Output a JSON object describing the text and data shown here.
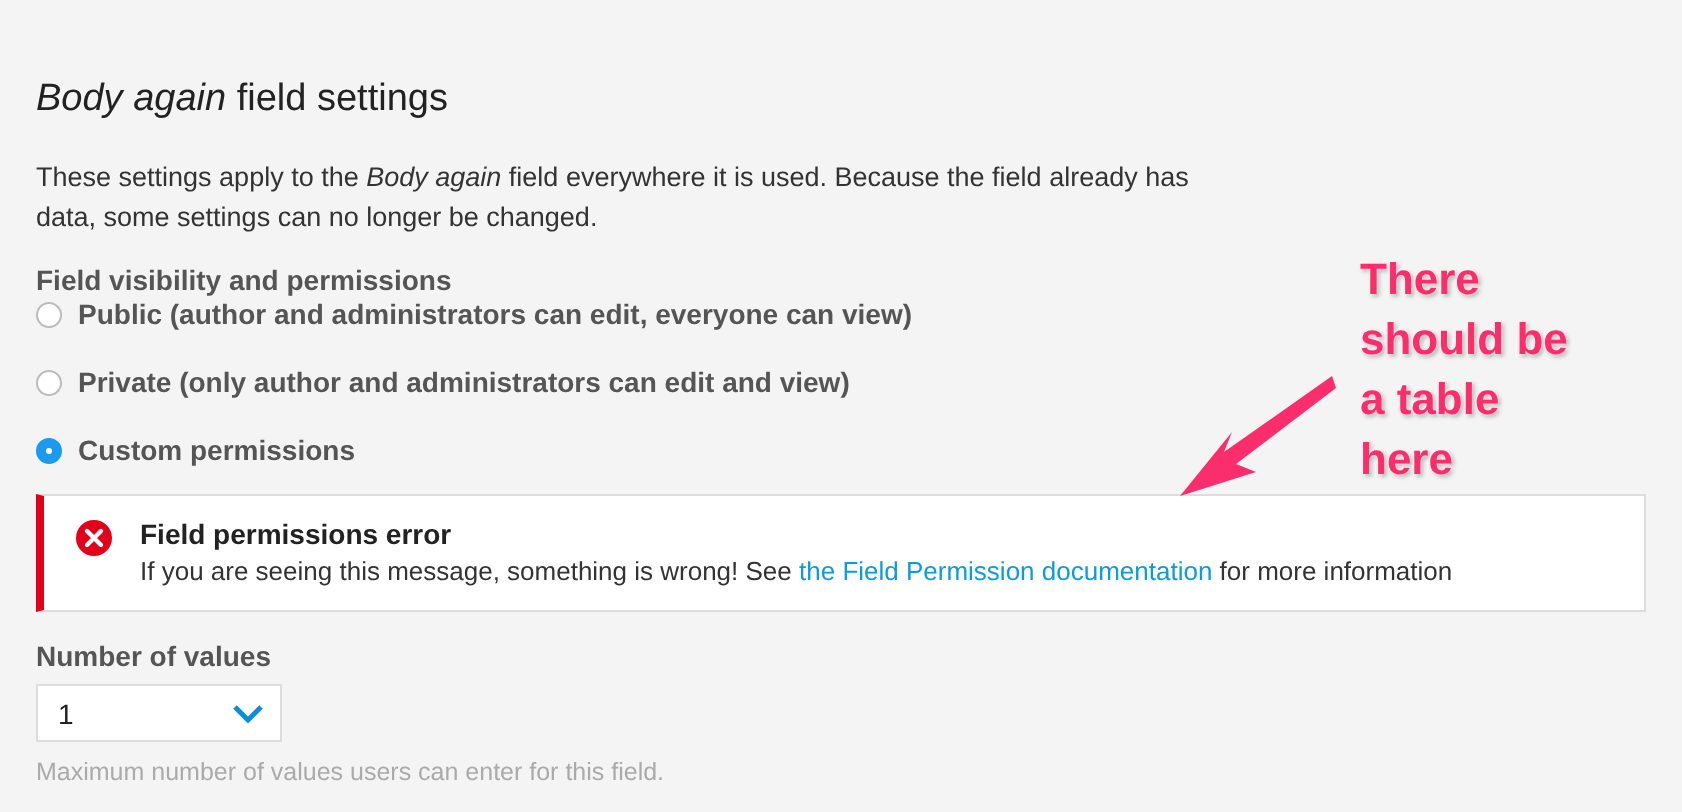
{
  "heading": {
    "title": "*Body again* field settings"
  },
  "intro": "These settings apply to the *Body again* field everywhere it is used. Because the field already has data, some settings can no longer be changed.",
  "visibility": {
    "label": "Field visibility and permissions",
    "options": [
      {
        "label": "Public (author and administrators can edit, everyone can view)",
        "selected": false
      },
      {
        "label": "Private (only author and administrators can edit and view)",
        "selected": false
      },
      {
        "label": "Custom permissions",
        "selected": true
      }
    ]
  },
  "error": {
    "title": "Field permissions error",
    "text_before": "If you are seeing this message, something is wrong! See",
    "link": "the Field Permission documentation",
    "text_after": "for more information"
  },
  "number_of_values": {
    "label": "Number of values",
    "value": "1",
    "hint": "Maximum number of values users can enter for this field."
  },
  "annotation": {
    "text": "There should be a table here"
  }
}
